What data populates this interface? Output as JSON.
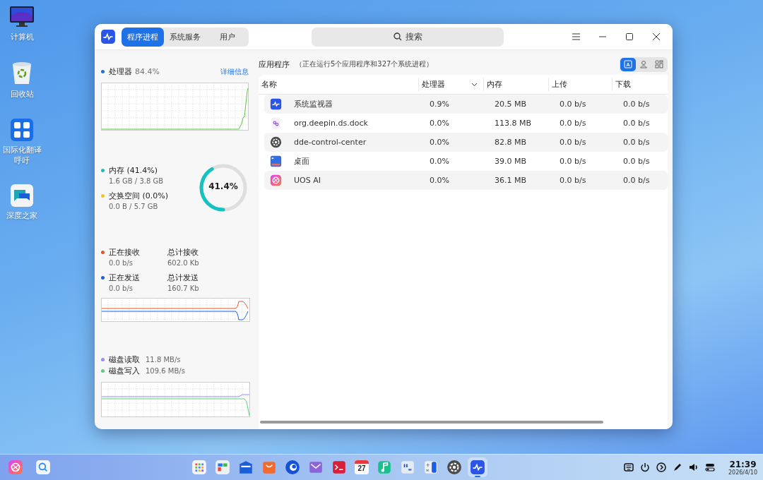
{
  "desktop_icons": [
    {
      "label": "计算机",
      "kind": "computer"
    },
    {
      "label": "回收站",
      "kind": "trash"
    },
    {
      "label": "国际化翻译呼吁",
      "kind": "translate"
    },
    {
      "label": "深度之家",
      "kind": "chat"
    }
  ],
  "window": {
    "tabs": [
      {
        "label": "程序进程",
        "selected": true
      },
      {
        "label": "系统服务",
        "selected": false
      },
      {
        "label": "用户",
        "selected": false
      }
    ],
    "search": {
      "placeholder": "搜索"
    },
    "sidebar": {
      "cpu": {
        "label": "处理器",
        "value": "84.4%",
        "link": "详细信息",
        "color": "#1a73e8"
      },
      "memory": [
        {
          "label": "内存 (41.4%)",
          "detail": "1.6 GB / 3.8 GB",
          "color": "#14c2c2"
        },
        {
          "label": "交换空间 (0.0%)",
          "detail": "0.0 B / 5.7 GB",
          "color": "#f5c518"
        }
      ],
      "memory_gauge": {
        "reading": "41.4%",
        "level": 0.414
      },
      "network": [
        {
          "label": "正在接收",
          "value": "0.0 b/s",
          "total_label": "总计接收",
          "total": "602.0 Kb",
          "color": "#e8541c"
        },
        {
          "label": "正在发送",
          "value": "0.0 b/s",
          "total_label": "总计发送",
          "total": "160.7 Kb",
          "color": "#1c5fe8"
        }
      ],
      "disk": [
        {
          "label": "磁盘读取",
          "value": "11.8 MB/s",
          "color": "#9b8cf5"
        },
        {
          "label": "磁盘写入",
          "value": "109.6 MB/s",
          "color": "#5ad07a"
        }
      ]
    },
    "content": {
      "title": "应用程序",
      "subtitle": "（正在运行5个应用程序和327个系统进程）",
      "view_buttons": [
        {
          "kind": "app",
          "selected": true
        },
        {
          "kind": "user",
          "selected": false
        },
        {
          "kind": "all",
          "selected": false
        }
      ],
      "columns": [
        {
          "label": "名称",
          "sorted": false
        },
        {
          "label": "处理器",
          "sorted": true
        },
        {
          "label": "内存",
          "sorted": false
        },
        {
          "label": "上传",
          "sorted": false
        },
        {
          "label": "下载",
          "sorted": false
        }
      ],
      "rows": [
        {
          "kind": "monitor",
          "name": "系统监视器",
          "cpu": "0.9%",
          "memory": "20.5 MB",
          "upload": "0.0 b/s",
          "download": "0.0 b/s"
        },
        {
          "kind": "dock",
          "name": "org.deepin.ds.dock",
          "cpu": "0.0%",
          "memory": "113.8 MB",
          "upload": "0.0 b/s",
          "download": "0.0 b/s"
        },
        {
          "kind": "settings",
          "name": "dde-control-center",
          "cpu": "0.0%",
          "memory": "82.8 MB",
          "upload": "0.0 b/s",
          "download": "0.0 b/s"
        },
        {
          "kind": "desktop",
          "name": "桌面",
          "cpu": "0.0%",
          "memory": "39.0 MB",
          "upload": "0.0 b/s",
          "download": "0.0 b/s"
        },
        {
          "kind": "ai",
          "name": "UOS AI",
          "cpu": "0.0%",
          "memory": "36.1 MB",
          "upload": "0.0 b/s",
          "download": "0.0 b/s"
        }
      ]
    }
  },
  "taskbar": {
    "left": [
      {
        "kind": "ai",
        "selected": false
      },
      {
        "kind": "search",
        "selected": false
      }
    ],
    "dock": [
      {
        "kind": "launcher",
        "selected": false
      },
      {
        "kind": "multitask",
        "selected": false
      },
      {
        "kind": "files",
        "selected": false
      },
      {
        "kind": "store",
        "selected": false
      },
      {
        "kind": "browser",
        "selected": false
      },
      {
        "kind": "mail",
        "selected": false
      },
      {
        "kind": "terminal",
        "selected": false
      },
      {
        "kind": "calendar",
        "text": "27",
        "selected": false
      },
      {
        "kind": "music",
        "selected": false
      },
      {
        "kind": "notes",
        "selected": false
      },
      {
        "kind": "calculator",
        "selected": false
      },
      {
        "kind": "settings",
        "selected": false
      },
      {
        "kind": "monitor",
        "selected": true
      }
    ],
    "tray": [
      {
        "kind": "keyboard"
      },
      {
        "kind": "power"
      },
      {
        "kind": "next"
      },
      {
        "kind": "pen"
      },
      {
        "kind": "volume"
      },
      {
        "kind": "toggles"
      }
    ],
    "time": "21:39",
    "date": "2026/4/10"
  }
}
